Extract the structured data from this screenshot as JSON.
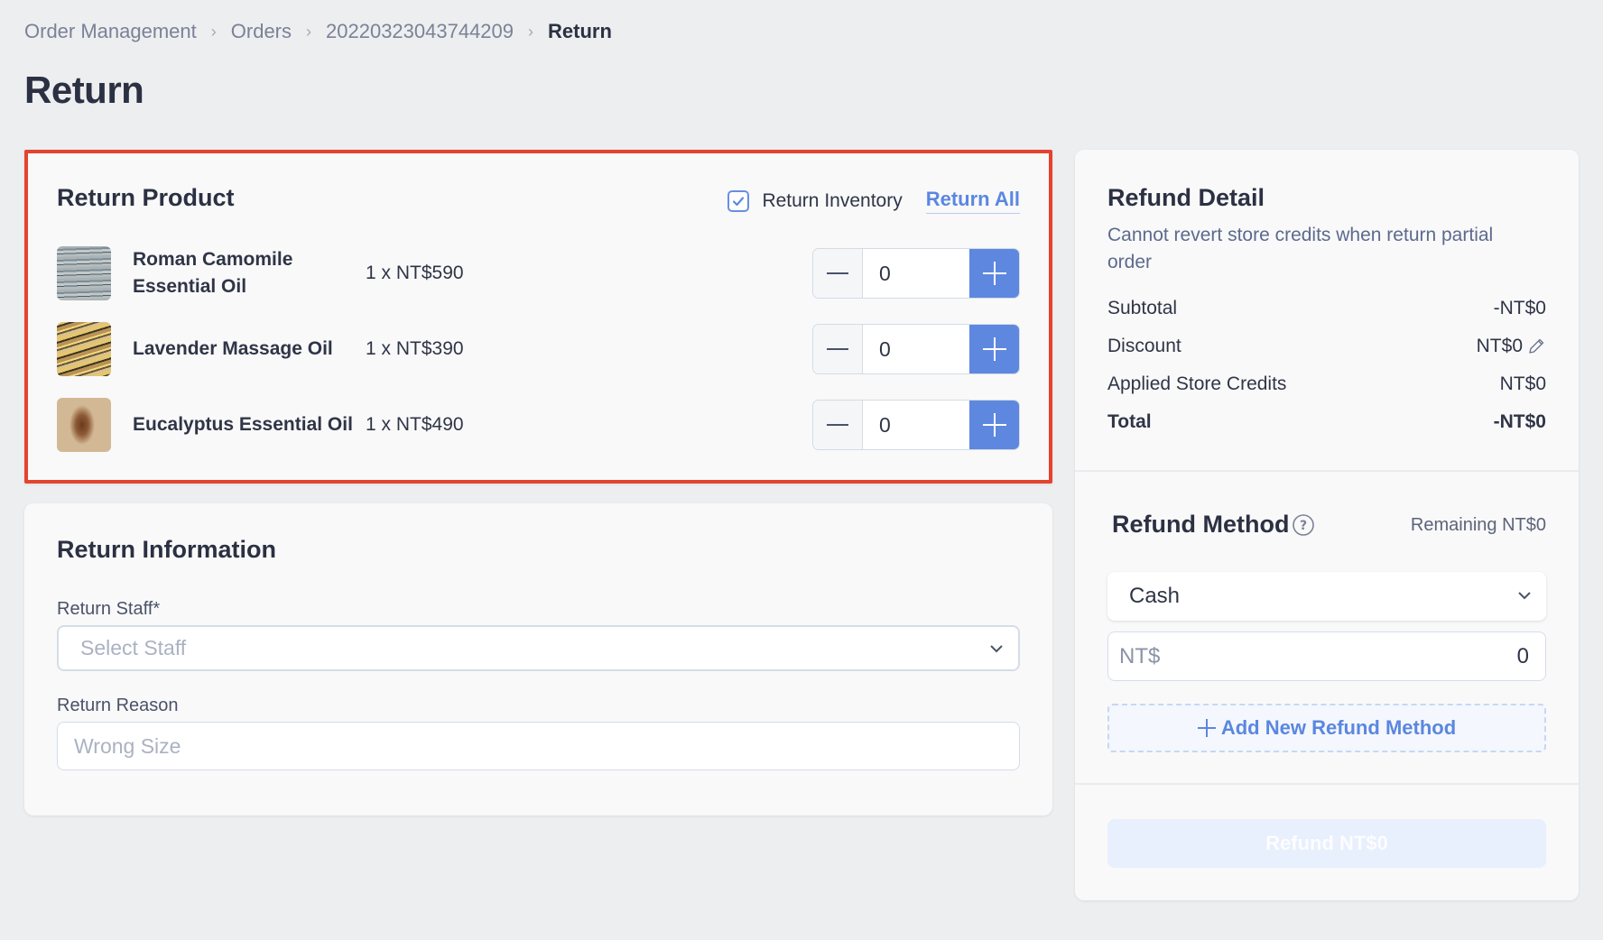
{
  "breadcrumb": [
    {
      "label": "Order Management"
    },
    {
      "label": "Orders"
    },
    {
      "label": "20220323043744209"
    },
    {
      "label": "Return"
    }
  ],
  "page_title": "Return",
  "return_product": {
    "title": "Return Product",
    "return_inventory_label": "Return Inventory",
    "return_inventory_checked": true,
    "return_all_label": "Return All",
    "products": [
      {
        "name": "Roman Camomile Essential Oil",
        "price": "1 x NT$590",
        "quantity": "0",
        "thumbnail": "blue-gray-striped-image"
      },
      {
        "name": "Lavender Massage Oil",
        "price": "1 x NT$390",
        "quantity": "0",
        "thumbnail": "gold-striped-image"
      },
      {
        "name": "Eucalyptus Essential Oil",
        "price": "1 x NT$490",
        "quantity": "0",
        "thumbnail": "oil-bottle-image"
      }
    ]
  },
  "return_information": {
    "title": "Return Information",
    "staff_label": "Return Staff*",
    "staff_placeholder": "Select Staff",
    "reason_label": "Return Reason",
    "reason_placeholder": "Wrong Size"
  },
  "refund_detail": {
    "title": "Refund Detail",
    "note": "Cannot revert store credits when return partial order",
    "rows": [
      {
        "label": "Subtotal",
        "value": "-NT$0"
      },
      {
        "label": "Discount",
        "value": "NT$0"
      },
      {
        "label": "Applied Store Credits",
        "value": "NT$0"
      },
      {
        "label": "Total",
        "value": "-NT$0"
      }
    ]
  },
  "refund_method": {
    "title": "Refund Method",
    "remaining": "Remaining NT$0",
    "selected_method": "Cash",
    "currency_prefix": "NT$",
    "amount": "0",
    "add_label": "Add New Refund Method",
    "refund_button_label": "Refund NT$0"
  },
  "colors": {
    "accent": "#5e88df",
    "highlight_border": "#e5432e",
    "background": "#edeef0"
  }
}
